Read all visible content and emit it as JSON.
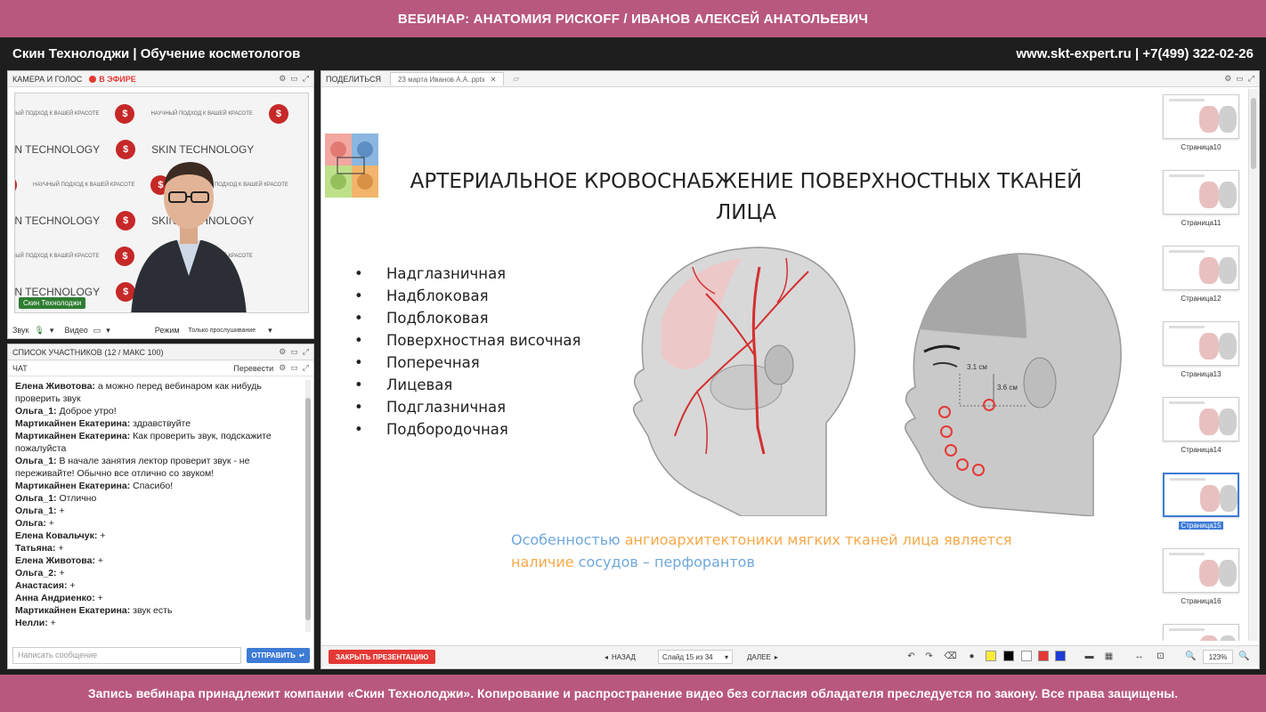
{
  "banner": {
    "title": "ВЕБИНАР: АНАТОМИЯ РИСКOFF / ИВАНОВ АЛЕКСЕЙ АНАТОЛЬЕВИЧ"
  },
  "brand": {
    "left": "Скин Технолоджи | Обучение косметологов",
    "right": "www.skt-expert.ru | +7(499) 322-02-26"
  },
  "camera": {
    "header": "КАМЕРА И ГОЛОС",
    "live": "В ЭФИРЕ",
    "backdrop_brand": "SKIN TECHNOLOGY",
    "backdrop_slogan": "НАУЧНЫЙ ПОДХОД К ВАШЕЙ КРАСОТЕ",
    "name_badge": "Скин Технолоджи",
    "sound_label": "Звук",
    "video_label": "Видео",
    "mode_label": "Режим",
    "mode_value": "Только прослушивание"
  },
  "chat": {
    "participants_header": "СПИСОК УЧАСТНИКОВ (12 / МАКС 100)",
    "tab_label": "ЧАТ",
    "translate_label": "Перевести",
    "messages": [
      {
        "author": "Елена Животова:",
        "text": " а можно перед вебинаром как нибудь проверить звук"
      },
      {
        "author": "Ольга_1:",
        "text": " Доброе утро!"
      },
      {
        "author": "Мартикайнен Екатерина:",
        "text": " здравствуйте"
      },
      {
        "author": "Мартикайнен Екатерина:",
        "text": " Как проверить звук, подскажите пожалуйста"
      },
      {
        "author": "Ольга_1:",
        "text": " В начале занятия лектор проверит звук - не переживайте! Обычно все отлично со звуком!"
      },
      {
        "author": "Мартикайнен Екатерина:",
        "text": " Спасибо!"
      },
      {
        "author": "Ольга_1:",
        "text": " Отлично"
      },
      {
        "author": "Ольга_1:",
        "text": " +"
      },
      {
        "author": "Ольга:",
        "text": " +"
      },
      {
        "author": "Елена Ковальчук:",
        "text": " +"
      },
      {
        "author": "Татьяна:",
        "text": " +"
      },
      {
        "author": "Елена Животова:",
        "text": " +"
      },
      {
        "author": "Ольга_2:",
        "text": " +"
      },
      {
        "author": "Анастасия:",
        "text": " +"
      },
      {
        "author": "Анна Андриенко:",
        "text": " +"
      },
      {
        "author": "Мартикайнен Екатерина:",
        "text": " звук есть"
      },
      {
        "author": "Нелли:",
        "text": " +"
      }
    ],
    "input_placeholder": "Написать сообщение",
    "send_label": "ОТПРАВИТЬ"
  },
  "presentation": {
    "share_label": "ПОДЕЛИТЬСЯ",
    "file_tab": "23 марта Иванов А.А..pptx",
    "slide": {
      "title": "АРТЕРИАЛЬНОЕ КРОВОСНАБЖЕНИЕ ПОВЕРХНОСТНЫХ ТКАНЕЙ ЛИЦА",
      "bullets": [
        "Надглазничная",
        "Надблоковая",
        "Подблоковая",
        "Поверхностная височная",
        "Поперечная",
        "Лицевая",
        "Подглазничная",
        "Подбородочная"
      ],
      "footer_part1": "Особенностью ",
      "footer_part2": "ангиоархитектоники мягких тканей лица является",
      "footer_part3": "наличие ",
      "footer_part4": "сосудов – перфорантов",
      "measure1": "3.1 см",
      "measure2": "3.6 см"
    },
    "thumbnails": [
      {
        "caption": "Страница10"
      },
      {
        "caption": "Страница11"
      },
      {
        "caption": "Страница12"
      },
      {
        "caption": "Страница13"
      },
      {
        "caption": "Страница14"
      },
      {
        "caption": "Страница15",
        "active": true
      },
      {
        "caption": "Страница16"
      },
      {
        "caption": ""
      }
    ],
    "toolbar": {
      "close_label": "ЗАКРЫТЬ ПРЕЗЕНТАЦИЮ",
      "back_label": "НАЗАД",
      "slide_indicator": "Слайд 15 из 34",
      "next_label": "ДАЛЕЕ",
      "zoom": "123%"
    },
    "colors": {
      "swatches": [
        "#ffeb3b",
        "#000000",
        "#ffffff",
        "#e53935",
        "#1e3cd6"
      ]
    }
  },
  "footer": {
    "notice": "Запись вебинара принадлежит компании «Скин Технолоджи». Копирование и распространение видео без согласия обладателя преследуется по закону. Все права защищены."
  },
  "theme": {
    "accent": "#b8587e",
    "button_blue": "#3d7bd6",
    "danger": "#e53935"
  }
}
